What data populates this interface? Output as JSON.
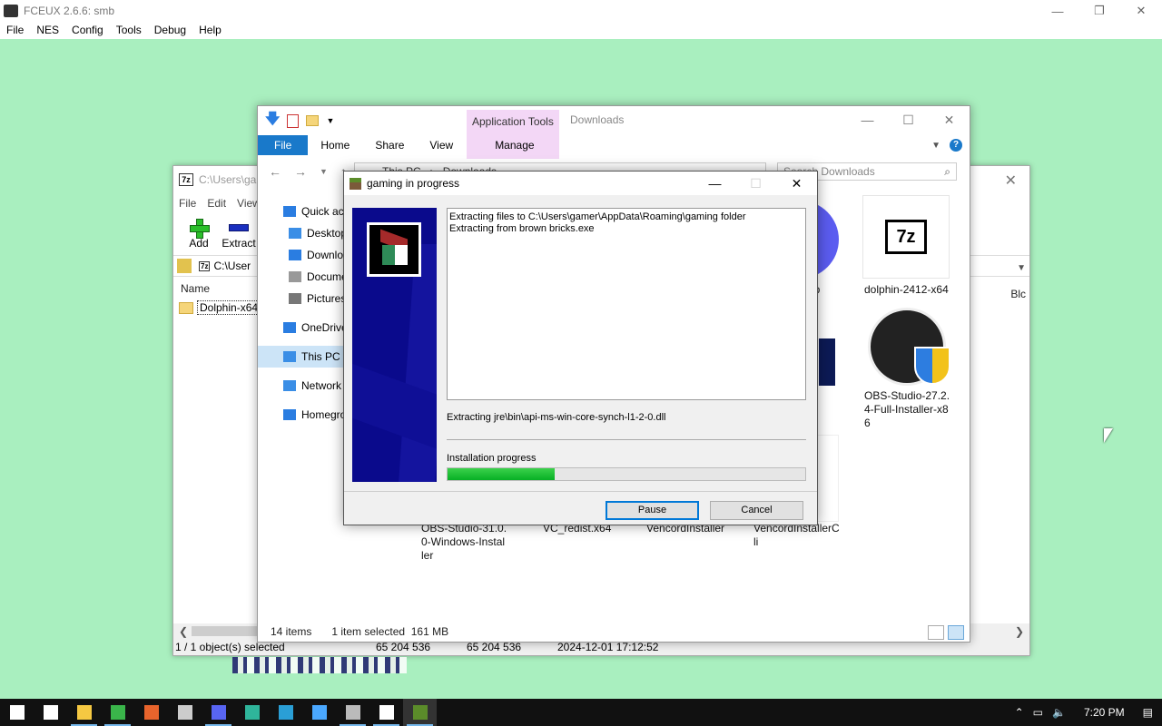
{
  "fceux": {
    "title": "FCEUX 2.6.6: smb",
    "menu": [
      "File",
      "NES",
      "Config",
      "Tools",
      "Debug",
      "Help"
    ],
    "controls": {
      "minimize": "—",
      "restore": "❐",
      "close": "✕"
    }
  },
  "sevenzip": {
    "title": "C:\\Users\\gar",
    "menu": [
      "File",
      "Edit",
      "View"
    ],
    "toolbar": {
      "add": "Add",
      "extract": "Extract"
    },
    "path": "C:\\User",
    "column_name": "Name",
    "column_right": "Blc",
    "row": "Dolphin-x64",
    "status": {
      "selected": "1 / 1 object(s) selected",
      "size1": "65 204 536",
      "size2": "65 204 536",
      "date": "2024-12-01 17:12:52"
    }
  },
  "explorer": {
    "app_tools": "Application Tools",
    "title": "Downloads",
    "tabs": {
      "file": "File",
      "home": "Home",
      "share": "Share",
      "view": "View",
      "manage": "Manage"
    },
    "address": {
      "a": "This PC",
      "b": "Downloads"
    },
    "search_placeholder": "Search Downloads",
    "sidebar": [
      {
        "label": "Quick acc",
        "color": "#2a7de1"
      },
      {
        "label": "Desktop",
        "color": "#3a8ee6"
      },
      {
        "label": "Downlo",
        "color": "#2a7de1"
      },
      {
        "label": "Docume",
        "color": "#999999"
      },
      {
        "label": "Pictures",
        "color": "#777777"
      },
      {
        "label": "OneDrive",
        "color": "#2a7de1"
      },
      {
        "label": "This PC",
        "color": "#3a8ee6"
      },
      {
        "label": "Network",
        "color": "#3a8ee6"
      },
      {
        "label": "Homegro",
        "color": "#2a7de1"
      }
    ],
    "files": {
      "up": "up",
      "dolphin": "dolphin-2412-x64",
      "obs27": "OBS-Studio-27.2.\n4-Full-Installer-x8\n6",
      "obs31": "OBS-Studio-31.0.\n0-Windows-Instal\nler",
      "vcredist": "VC_redist.x64",
      "vencord": "VencordInstaller",
      "vencordcli": "VencordInstallerC\nli"
    },
    "status": {
      "items": "14 items",
      "selected": "1 item selected  161 MB"
    }
  },
  "installer": {
    "title": "gaming in progress",
    "log_line1": "Extracting files to C:\\Users\\gamer\\AppData\\Roaming\\gaming folder",
    "log_line2": "Extracting from brown bricks.exe",
    "current_file": "Extracting jre\\bin\\api-ms-win-core-synch-l1-2-0.dll",
    "progress_label": "Installation progress",
    "progress_fraction": 0.3,
    "pause_label": "Pause",
    "cancel_label": "Cancel"
  },
  "taskbar": {
    "clock": "7:20 PM",
    "apps": [
      {
        "name": "start-button",
        "color": "#ffffff"
      },
      {
        "name": "search-icon",
        "color": "#ffffff"
      },
      {
        "name": "file-explorer-icon",
        "color": "#f5c842"
      },
      {
        "name": "green-app-icon",
        "color": "#3ab54a"
      },
      {
        "name": "game-app-icon",
        "color": "#e8642c"
      },
      {
        "name": "obs-icon",
        "color": "#cccccc"
      },
      {
        "name": "discord-icon",
        "color": "#5865f2"
      },
      {
        "name": "edge-icon",
        "color": "#2fb59b"
      },
      {
        "name": "remote-app-icon",
        "color": "#2a9fd6"
      },
      {
        "name": "store-icon",
        "color": "#4aa8ff"
      },
      {
        "name": "fceux-icon",
        "color": "#bbbbbb"
      },
      {
        "name": "7zip-icon",
        "color": "#ffffff"
      },
      {
        "name": "minecraft-icon",
        "color": "#5b8c2a"
      }
    ]
  }
}
